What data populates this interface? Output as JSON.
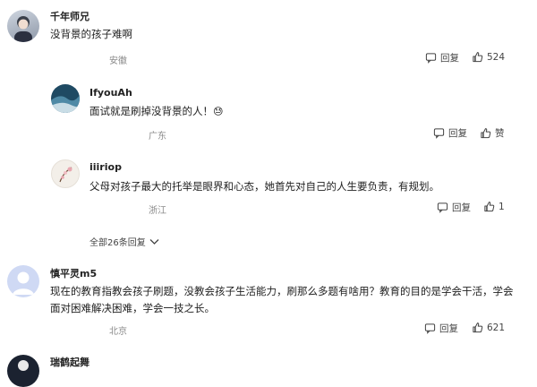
{
  "comments": [
    {
      "username": "千年师兄",
      "text": "没背景的孩子难啊",
      "location": "安徽",
      "reply_label": "回复",
      "like_count": "524"
    },
    {
      "username": "IfyouAh",
      "text": "面试就是刷掉没背景的人！",
      "emoji": "😓",
      "location": "广东",
      "reply_label": "回复",
      "like_count": "赞"
    },
    {
      "username": "iiiriop",
      "text": "父母对孩子最大的托举是眼界和心态，她首先对自己的人生要负责，有规划。",
      "location": "浙江",
      "reply_label": "回复",
      "like_count": "1"
    },
    {
      "username": "慎平灵m5",
      "text_line1": "现在的教育指教会孩子刷题，没教会孩子生活能力，刷那么多题有啥用？教育的目的是学会干活，学会",
      "text_line2": "面对困难解决困难，学会一技之长。",
      "location": "北京",
      "reply_label": "回复",
      "like_count": "621"
    },
    {
      "username": "瑞鹤起舞"
    }
  ],
  "expand_replies_label": "全部26条回复",
  "colors": {
    "text": "#222222",
    "meta": "#8a8a8a",
    "action": "#444444"
  }
}
